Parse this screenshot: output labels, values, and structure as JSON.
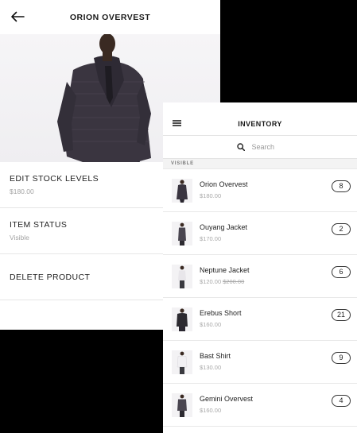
{
  "detail": {
    "title": "ORION OVERVEST",
    "menu": [
      {
        "label": "EDIT STOCK LEVELS",
        "sub": "$180.00"
      },
      {
        "label": "ITEM STATUS",
        "sub": "Visible"
      },
      {
        "label": "DELETE PRODUCT",
        "sub": ""
      }
    ]
  },
  "inventory": {
    "title": "INVENTORY",
    "search": {
      "placeholder": "Search"
    },
    "section": "VISIBLE",
    "items": [
      {
        "name": "Orion Overvest",
        "price": "$180.00",
        "old_price": "",
        "count": "8"
      },
      {
        "name": "Ouyang Jacket",
        "price": "$170.00",
        "old_price": "",
        "count": "2"
      },
      {
        "name": "Neptune Jacket",
        "price": "$120.00",
        "old_price": "$200.00",
        "count": "6"
      },
      {
        "name": "Erebus Short",
        "price": "$160.00",
        "old_price": "",
        "count": "21"
      },
      {
        "name": "Bast Shirt",
        "price": "$130.00",
        "old_price": "",
        "count": "9"
      },
      {
        "name": "Gemini Overvest",
        "price": "$160.00",
        "old_price": "",
        "count": "4"
      }
    ]
  },
  "icons": {
    "back": "arrow-left-icon",
    "menu": "hamburger-menu-icon",
    "search": "search-icon"
  }
}
